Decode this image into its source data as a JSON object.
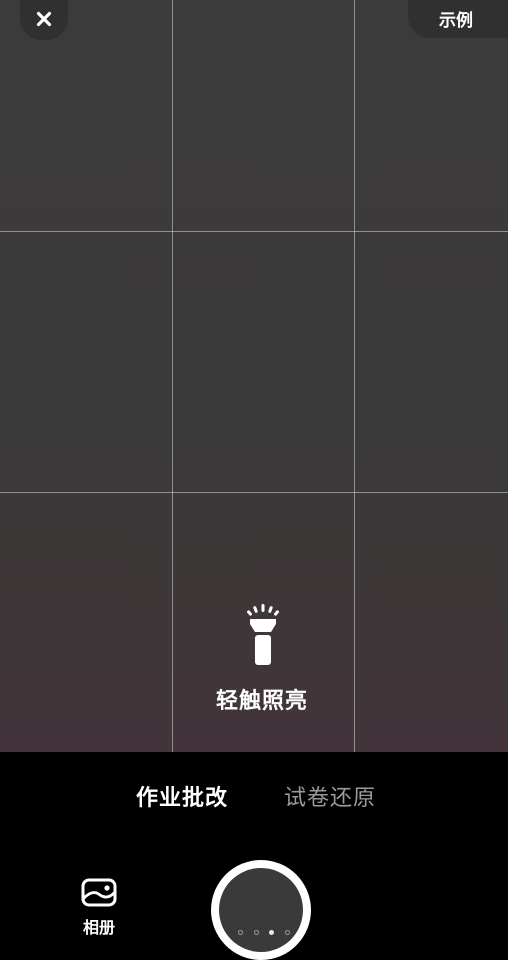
{
  "top_bar": {
    "close_icon": "close-icon",
    "example_label": "示例"
  },
  "viewfinder": {
    "grid": "3x3",
    "torch_icon": "flashlight-icon",
    "torch_label": "轻触照亮"
  },
  "mode_tabs": [
    {
      "label": "作业批改",
      "active": true
    },
    {
      "label": "试卷还原",
      "active": false
    }
  ],
  "bottom_bar": {
    "album_icon": "photo-album-icon",
    "album_label": "相册",
    "shutter_icon": "shutter-button",
    "page_indicator": {
      "count": 4,
      "active_index": 2
    }
  },
  "colors": {
    "background": "#000000",
    "viewfinder": "#3b3a3a",
    "grid_line": "#d7d7d7",
    "text_active": "#ffffff",
    "text_inactive": "#9a9a9a"
  }
}
